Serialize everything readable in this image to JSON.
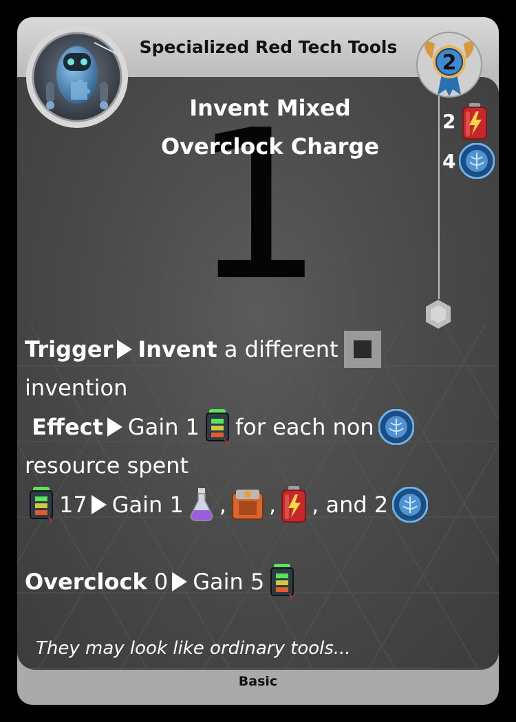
{
  "card": {
    "header_title": "Specialized Red Tech Tools",
    "footer_label": "Basic",
    "level": "2",
    "big_number": "1",
    "title_line1": "Invent Mixed",
    "title_line2": "Overclock Charge",
    "costs": [
      {
        "amount": "2",
        "icon": "battery-icon"
      },
      {
        "amount": "4",
        "icon": "blue-token-icon"
      }
    ],
    "rules": {
      "trigger_keyword": "Trigger",
      "trigger_verb": "Invent",
      "trigger_text": "a different",
      "trigger_text2": "invention",
      "effect_keyword": "Effect",
      "effect_text1": "Gain 1",
      "effect_text2": "for each non",
      "effect_text3": "resource spent",
      "threshold_value": "17",
      "threshold_text": "Gain 1",
      "comma1": ",",
      "comma2": ",",
      "threshold_end": ", and 2",
      "overclock_keyword": "Overclock",
      "overclock_value": "0",
      "overclock_text": "Gain 5"
    },
    "flavor": "They may look like ordinary tools..."
  },
  "colors": {
    "panel": "#4a4a4a",
    "frame": "#c4c4c4",
    "text": "#ffffff",
    "badge_blue": "#2b6fb0",
    "badge_gold": "#d89a3a"
  }
}
